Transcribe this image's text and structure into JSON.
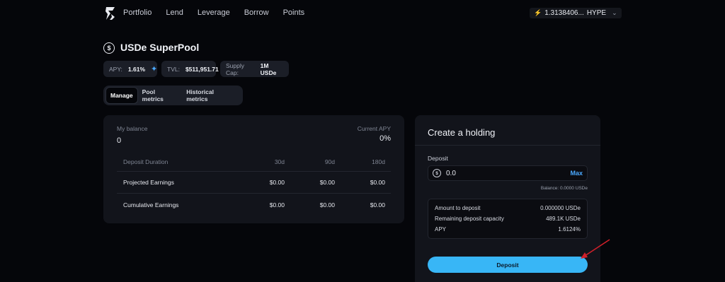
{
  "nav": {
    "items": [
      "Portfolio",
      "Lend",
      "Leverage",
      "Borrow",
      "Points"
    ],
    "wallet_amount": "1.3138406...",
    "wallet_token": "HYPE"
  },
  "pool": {
    "icon_letter": "$",
    "title": "USDe SuperPool",
    "stats": [
      {
        "label": "APY:",
        "value": "1.61%"
      },
      {
        "label": "TVL:",
        "value": "$511,951.71"
      },
      {
        "label": "Supply Cap:",
        "value": "1M USDe"
      }
    ]
  },
  "tabs": [
    {
      "label": "Manage",
      "active": true
    },
    {
      "label": "Pool metrics",
      "active": false
    },
    {
      "label": "Historical metrics",
      "active": false
    }
  ],
  "balance_card": {
    "balance_label": "My balance",
    "balance_value": "0",
    "apy_label": "Current APY",
    "apy_value": "0%",
    "table": {
      "headers": [
        "Deposit Duration",
        "30d",
        "90d",
        "180d"
      ],
      "rows": [
        [
          "Projected Earnings",
          "$0.00",
          "$0.00",
          "$0.00"
        ],
        [
          "Cumulative Earnings",
          "$0.00",
          "$0.00",
          "$0.00"
        ]
      ]
    }
  },
  "holding_card": {
    "title": "Create a holding",
    "deposit_label": "Deposit",
    "input_icon": "$",
    "input_value": "0.0",
    "max_label": "Max",
    "balance_text": "Balance: 0.0000 USDe",
    "info": [
      {
        "label": "Amount to deposit",
        "value": "0.000000 USDe"
      },
      {
        "label": "Remaining deposit capacity",
        "value": "489.1K USDe"
      },
      {
        "label": "APY",
        "value": "1.6124%"
      }
    ],
    "deposit_button": "Deposit"
  },
  "colors": {
    "background": "#05060a",
    "card": "#12141b",
    "accent": "#38b6f6",
    "link": "#4aa9ff",
    "annotation_arrow": "#d0202a"
  }
}
